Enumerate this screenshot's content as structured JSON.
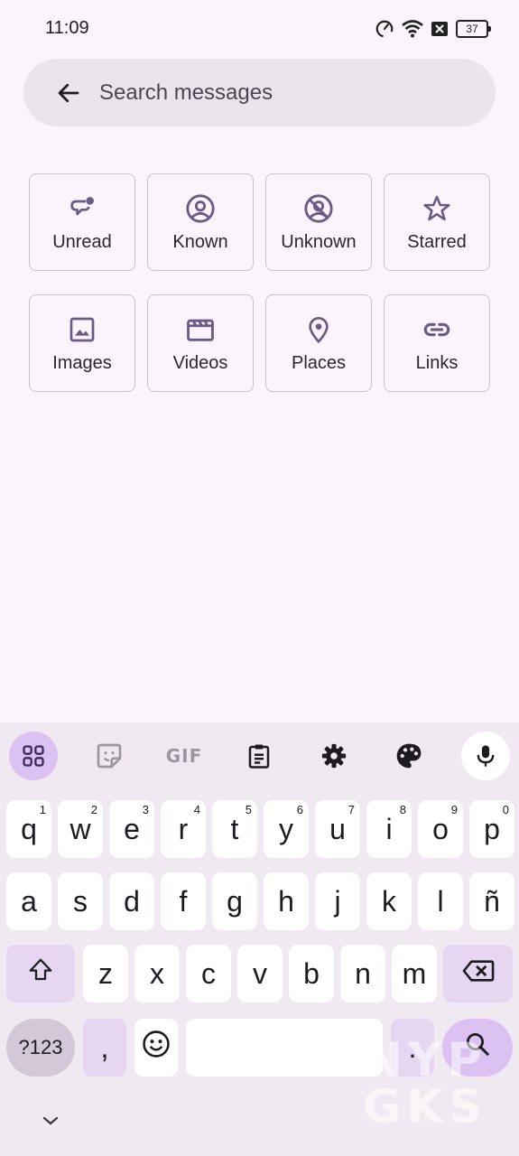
{
  "status_bar": {
    "time": "11:09",
    "battery": "37",
    "icons": [
      "data-saver-icon",
      "wifi-icon",
      "no-sim-icon",
      "battery-icon"
    ]
  },
  "search": {
    "placeholder": "Search messages",
    "back_icon": "arrow-left-icon"
  },
  "filters": [
    {
      "label": "Unread",
      "icon": "unread-chat-icon"
    },
    {
      "label": "Known",
      "icon": "contact-circle-icon"
    },
    {
      "label": "Unknown",
      "icon": "unknown-contact-icon"
    },
    {
      "label": "Starred",
      "icon": "star-icon"
    },
    {
      "label": "Images",
      "icon": "image-icon"
    },
    {
      "label": "Videos",
      "icon": "video-icon"
    },
    {
      "label": "Places",
      "icon": "location-pin-icon"
    },
    {
      "label": "Links",
      "icon": "link-icon"
    }
  ],
  "keyboard": {
    "toolbar": {
      "items": [
        "apps-grid-icon",
        "sticker-icon",
        "gif-icon",
        "clipboard-icon",
        "settings-icon",
        "palette-icon",
        "mic-icon"
      ],
      "gif_label": "GIF"
    },
    "row1": [
      {
        "k": "q",
        "h": "1"
      },
      {
        "k": "w",
        "h": "2"
      },
      {
        "k": "e",
        "h": "3"
      },
      {
        "k": "r",
        "h": "4"
      },
      {
        "k": "t",
        "h": "5"
      },
      {
        "k": "y",
        "h": "6"
      },
      {
        "k": "u",
        "h": "7"
      },
      {
        "k": "i",
        "h": "8"
      },
      {
        "k": "o",
        "h": "9"
      },
      {
        "k": "p",
        "h": "0"
      }
    ],
    "row2": [
      "a",
      "s",
      "d",
      "f",
      "g",
      "h",
      "j",
      "k",
      "l",
      "ñ"
    ],
    "row3": [
      "z",
      "x",
      "c",
      "v",
      "b",
      "n",
      "m"
    ],
    "symbols_label": "?123",
    "comma": ",",
    "period": ".",
    "shift_icon": "shift-icon",
    "backspace_icon": "backspace-icon",
    "emoji_icon": "emoji-icon",
    "enter_icon": "search-icon",
    "collapse_icon": "chevron-down-icon"
  },
  "watermark": {
    "line1": "NYP",
    "line2": "GKS"
  },
  "colors": {
    "background": "#fcf4fc",
    "search_bg": "#ebe4ec",
    "accent": "#dcc2f3",
    "icon": "#6a5a86"
  }
}
